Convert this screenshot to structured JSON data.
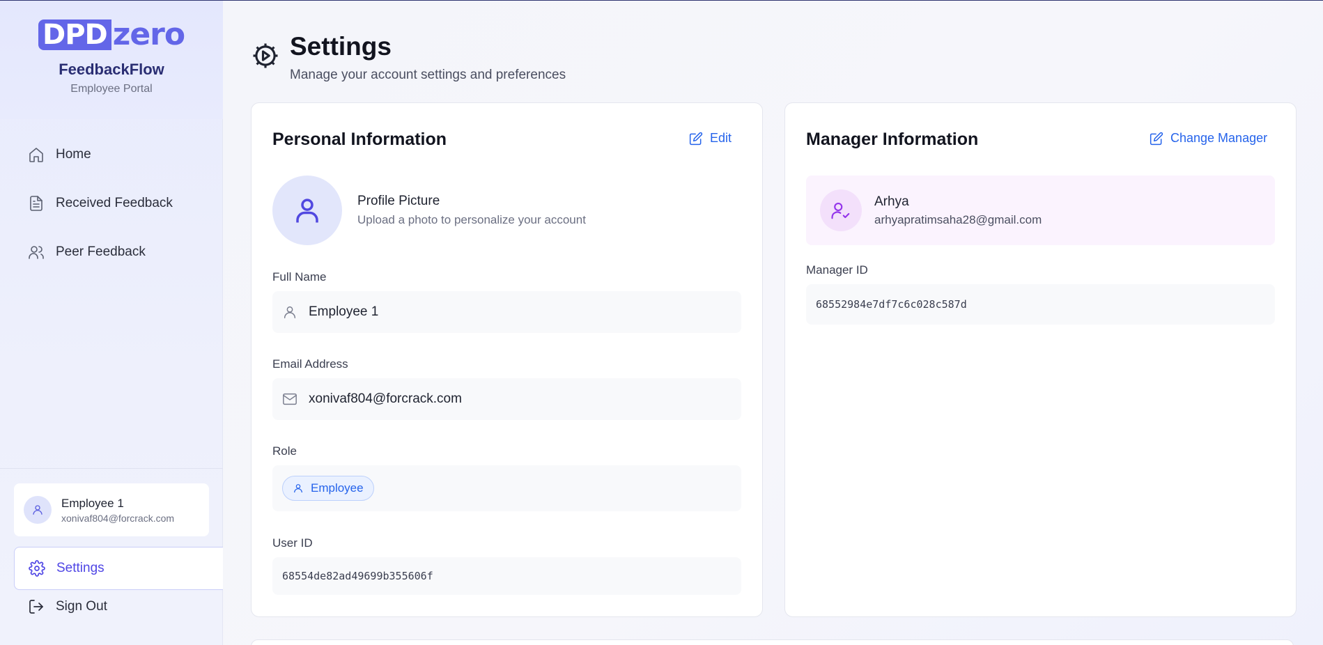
{
  "brand": {
    "logo_part1": "DPD",
    "logo_part2": "zero",
    "app_name": "FeedbackFlow",
    "app_sub": "Employee Portal"
  },
  "nav": {
    "items": [
      {
        "label": "Home",
        "icon": "home-icon"
      },
      {
        "label": "Received Feedback",
        "icon": "document-icon"
      },
      {
        "label": "Peer Feedback",
        "icon": "users-icon"
      }
    ],
    "settings_label": "Settings",
    "signout_label": "Sign Out"
  },
  "current_user": {
    "name": "Employee 1",
    "email": "xonivaf804@forcrack.com"
  },
  "page": {
    "title": "Settings",
    "subtitle": "Manage your account settings and preferences"
  },
  "personal": {
    "title": "Personal Information",
    "edit_label": "Edit",
    "profile_label": "Profile Picture",
    "profile_hint": "Upload a photo to personalize your account",
    "full_name_label": "Full Name",
    "full_name": "Employee 1",
    "email_label": "Email Address",
    "email": "xonivaf804@forcrack.com",
    "role_label": "Role",
    "role": "Employee",
    "user_id_label": "User ID",
    "user_id": "68554de82ad49699b355606f"
  },
  "manager": {
    "title": "Manager Information",
    "change_label": "Change Manager",
    "name": "Arhya",
    "email": "arhyapratimsaha28@gmail.com",
    "id_label": "Manager ID",
    "id": "68552984e7df7c6c028c587d"
  },
  "colors": {
    "accent": "#4f46e5",
    "link": "#2563eb",
    "manager_accent": "#9333ea"
  }
}
